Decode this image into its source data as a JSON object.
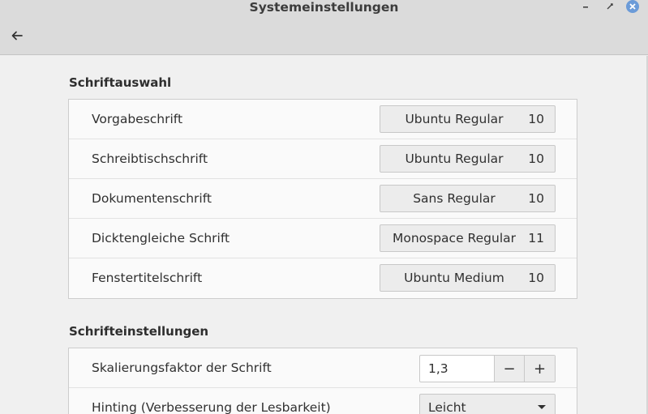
{
  "window": {
    "title": "Systemeinstellungen"
  },
  "icons": {
    "back": "back-arrow-icon",
    "minimize": "minimize-icon",
    "maximize": "maximize-icon",
    "close": "close-icon"
  },
  "font_selection": {
    "heading": "Schriftauswahl",
    "rows": [
      {
        "label": "Vorgabeschrift",
        "font": "Ubuntu Regular",
        "size": "10"
      },
      {
        "label": "Schreibtischschrift",
        "font": "Ubuntu Regular",
        "size": "10"
      },
      {
        "label": "Dokumentenschrift",
        "font": "Sans Regular",
        "size": "10"
      },
      {
        "label": "Dicktengleiche Schrift",
        "font": "Monospace Regular",
        "size": "11"
      },
      {
        "label": "Fenstertitelschrift",
        "font": "Ubuntu Medium",
        "size": "10"
      }
    ]
  },
  "font_settings": {
    "heading": "Schrifteinstellungen",
    "scaling": {
      "label": "Skalierungsfaktor der Schrift",
      "value": "1,3",
      "minus": "−",
      "plus": "+"
    },
    "hinting": {
      "label": "Hinting (Verbesserung der Lesbarkeit)",
      "value": "Leicht"
    }
  },
  "colors": {
    "close_button": "#6b9bd8",
    "header": "#dbdbdb",
    "background": "#f0f0f0"
  }
}
